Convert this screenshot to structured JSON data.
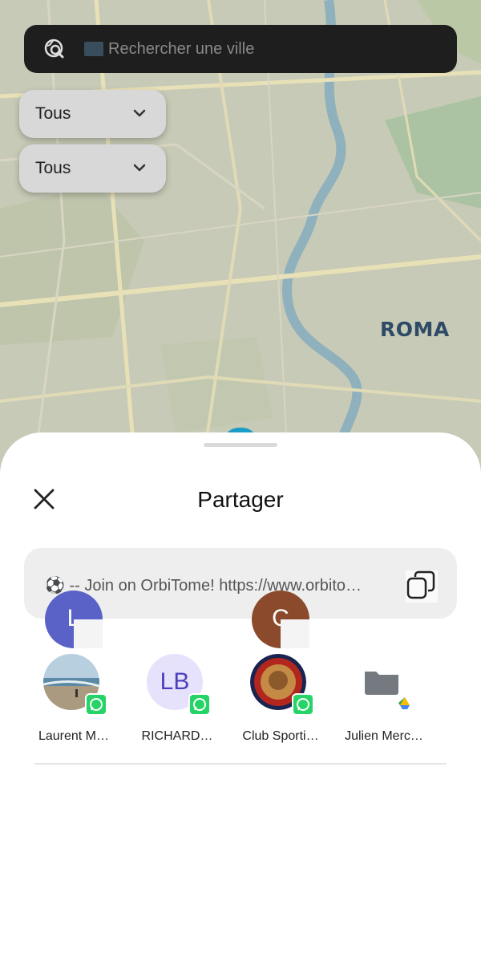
{
  "map": {
    "city_label": "ROMA"
  },
  "search": {
    "placeholder": "Rechercher une ville"
  },
  "filters": [
    {
      "label": "Tous"
    },
    {
      "label": "Tous"
    }
  ],
  "share_sheet": {
    "title": "Partager",
    "link_text": "⚽ -- Join on OrbiTome! https://www.orbito…"
  },
  "floating_avatars": [
    {
      "initial": "L",
      "color": "#5a62c8"
    },
    {
      "initial": "C",
      "color": "#8b4a2b"
    }
  ],
  "contacts": [
    {
      "name": "Laurent M…",
      "app": "whatsapp",
      "avatar": "photo-beach"
    },
    {
      "name": "RICHARD…",
      "app": "whatsapp",
      "avatar_initials": "LB"
    },
    {
      "name": "Club Sporti…",
      "app": "whatsapp",
      "avatar": "club-logo"
    },
    {
      "name": "Julien Merc…",
      "app": "google-drive",
      "avatar": "folder-icon"
    }
  ],
  "colors": {
    "search_bg": "#1e1e1e",
    "whatsapp": "#25d366",
    "avatar_lb_bg": "#e6e2fb",
    "avatar_lb_text": "#4c3fbf"
  }
}
